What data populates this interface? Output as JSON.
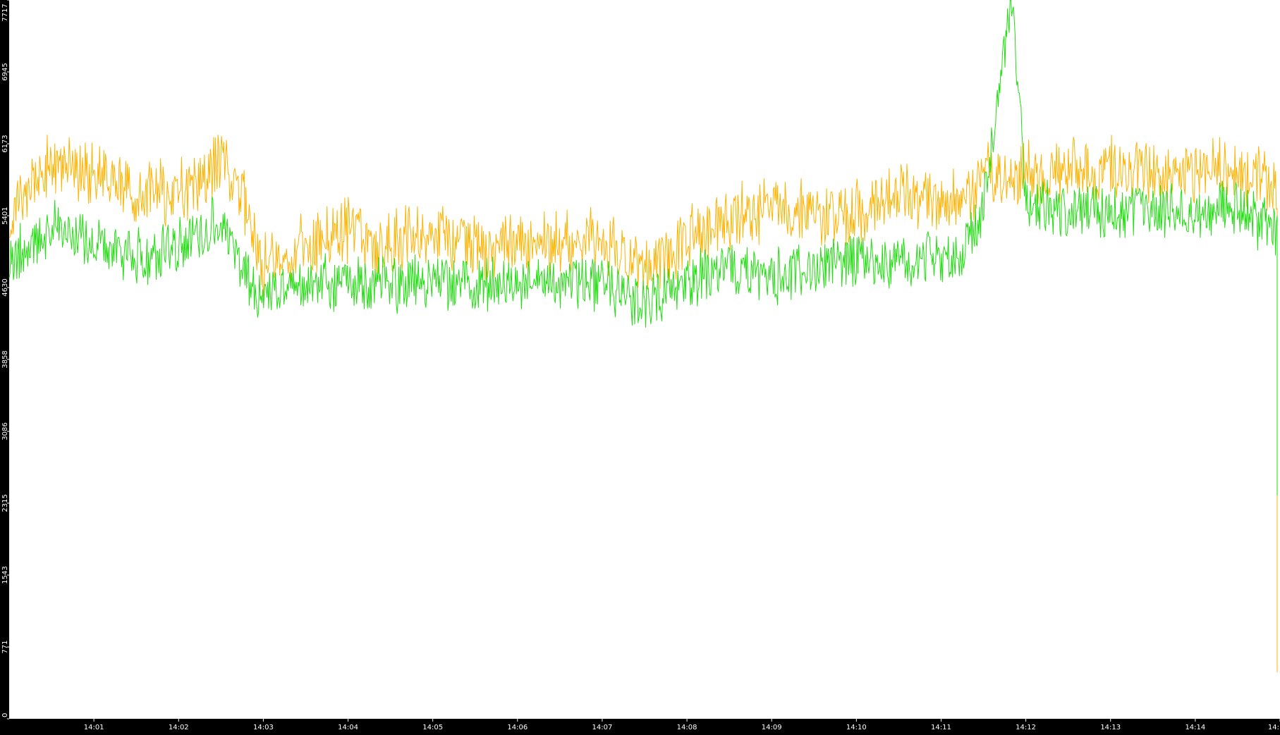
{
  "chart_data": {
    "type": "line",
    "title": "",
    "xlabel": "",
    "ylabel": "",
    "x_range": [
      "14:00:00",
      "14:15:00"
    ],
    "ylim": [
      0,
      7717
    ],
    "y_ticks": [
      "0",
      "771",
      "1543",
      "2315",
      "3086",
      "3858",
      "4630",
      "5401",
      "6173",
      "6945",
      "7717"
    ],
    "x_ticks": [
      "14:01",
      "14:02",
      "14:03",
      "14:04",
      "14:05",
      "14:06",
      "14:07",
      "14:08",
      "14:09",
      "14:10",
      "14:11",
      "14:12",
      "14:13",
      "14:14",
      "14:"
    ],
    "grid": false,
    "legend": "none",
    "colors": {
      "background": "#000000",
      "plot_background": "#ffffff",
      "axis_text": "#ffffff"
    },
    "series": [
      {
        "color": "#ffb300",
        "x": [
          "14:00:00",
          "14:00:30",
          "14:01:00",
          "14:01:30",
          "14:02:00",
          "14:02:30",
          "14:02:45",
          "14:03:00",
          "14:03:30",
          "14:04:00",
          "14:04:20",
          "14:04:30",
          "14:05:00",
          "14:05:30",
          "14:06:00",
          "14:06:30",
          "14:07:00",
          "14:07:30",
          "14:08:00",
          "14:08:30",
          "14:09:00",
          "14:09:30",
          "14:10:00",
          "14:10:30",
          "14:11:00",
          "14:11:15",
          "14:11:30",
          "14:11:50",
          "14:12:00",
          "14:12:30",
          "14:13:00",
          "14:13:30",
          "14:14:00",
          "14:14:30",
          "14:14:58"
        ],
        "values": [
          5450,
          6000,
          5850,
          5700,
          5650,
          5950,
          5600,
          4900,
          5050,
          5250,
          5000,
          5150,
          5200,
          5050,
          5150,
          5100,
          5150,
          4800,
          5150,
          5350,
          5500,
          5400,
          5450,
          5600,
          5550,
          5500,
          5900,
          5700,
          5900,
          5850,
          5950,
          5850,
          5850,
          5950,
          5650
        ]
      },
      {
        "color": "#22dd11",
        "x": [
          "14:00:00",
          "14:00:30",
          "14:01:00",
          "14:01:30",
          "14:02:00",
          "14:02:30",
          "14:02:45",
          "14:03:00",
          "14:03:30",
          "14:04:00",
          "14:04:20",
          "14:04:30",
          "14:05:00",
          "14:05:30",
          "14:06:00",
          "14:06:30",
          "14:07:00",
          "14:07:30",
          "14:08:00",
          "14:08:30",
          "14:09:00",
          "14:09:30",
          "14:10:00",
          "14:10:30",
          "14:11:00",
          "14:11:15",
          "14:11:30",
          "14:11:50",
          "14:12:00",
          "14:12:30",
          "14:13:00",
          "14:13:30",
          "14:14:00",
          "14:14:30",
          "14:14:58"
        ],
        "values": [
          4900,
          5300,
          5100,
          4950,
          5050,
          5350,
          4800,
          4500,
          4700,
          4650,
          4700,
          4650,
          4750,
          4650,
          4700,
          4700,
          4650,
          4450,
          4700,
          4800,
          4750,
          4850,
          4900,
          4900,
          4950,
          5000,
          5500,
          7717,
          5550,
          5450,
          5450,
          5450,
          5400,
          5500,
          5200
        ]
      }
    ]
  }
}
